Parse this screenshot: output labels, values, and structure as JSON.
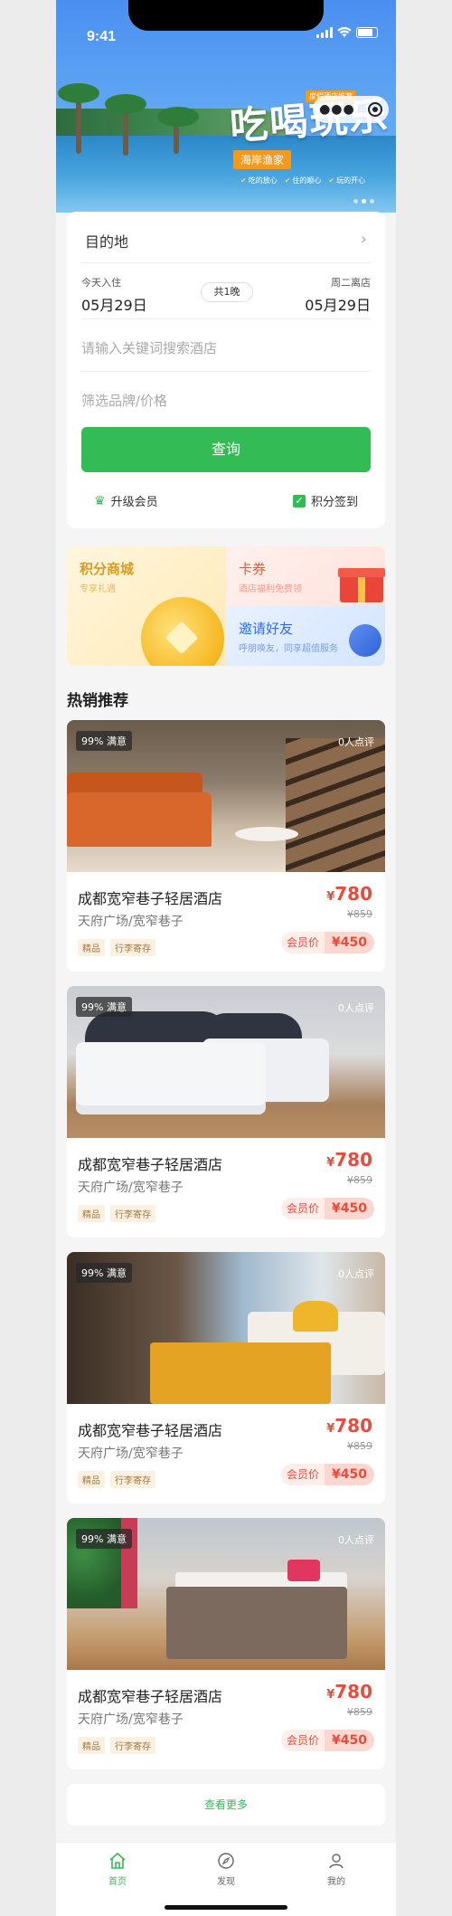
{
  "status": {
    "time": "9:41"
  },
  "banner": {
    "slogan": "吃喝玩乐",
    "tag": "海岸渔家",
    "badge": "度假酒店推荐",
    "perks": [
      "吃的放心",
      "住的顺心",
      "玩的开心"
    ]
  },
  "search": {
    "destination_label": "目的地",
    "checkin_label": "今天入住",
    "checkin_date": "05月29日",
    "nights": "共1晚",
    "checkout_label": "周二离店",
    "checkout_date": "05月29日",
    "keyword_placeholder": "请输入关键词搜索酒店",
    "brand_placeholder": "筛选品牌/价格",
    "query_button": "查询",
    "upgrade_member": "升级会员",
    "points_checkin": "积分签到"
  },
  "promos": {
    "mall": {
      "title": "积分商城",
      "subtitle": "专享礼遇"
    },
    "coupon": {
      "title": "卡券",
      "subtitle": "酒店福利免费领"
    },
    "invite": {
      "title": "邀请好友",
      "subtitle": "呼朋唤友，同享超值服务"
    }
  },
  "section_title": "热销推荐",
  "hotels": [
    {
      "satisfaction": "99% 满意",
      "reviews": "0人点评",
      "name": "成都宽窄巷子轻居酒店",
      "address": "天府广场/宽窄巷子",
      "tags": [
        "精品",
        "行李寄存"
      ],
      "currency": "¥",
      "price": "780",
      "original_price": "¥859",
      "member_label": "会员价",
      "member_price": "¥450"
    },
    {
      "satisfaction": "99% 满意",
      "reviews": "0人点评",
      "name": "成都宽窄巷子轻居酒店",
      "address": "天府广场/宽窄巷子",
      "tags": [
        "精品",
        "行李寄存"
      ],
      "currency": "¥",
      "price": "780",
      "original_price": "¥859",
      "member_label": "会员价",
      "member_price": "¥450"
    },
    {
      "satisfaction": "99% 满意",
      "reviews": "0人点评",
      "name": "成都宽窄巷子轻居酒店",
      "address": "天府广场/宽窄巷子",
      "tags": [
        "精品",
        "行李寄存"
      ],
      "currency": "¥",
      "price": "780",
      "original_price": "¥859",
      "member_label": "会员价",
      "member_price": "¥450"
    },
    {
      "satisfaction": "99% 满意",
      "reviews": "0人点评",
      "name": "成都宽窄巷子轻居酒店",
      "address": "天府广场/宽窄巷子",
      "tags": [
        "精品",
        "行李寄存"
      ],
      "currency": "¥",
      "price": "780",
      "original_price": "¥859",
      "member_label": "会员价",
      "member_price": "¥450"
    }
  ],
  "load_more": "查看更多",
  "tabbar": [
    {
      "label": "首页",
      "icon": "home-icon",
      "active": true
    },
    {
      "label": "发现",
      "icon": "compass-icon",
      "active": false
    },
    {
      "label": "我的",
      "icon": "user-icon",
      "active": false
    }
  ],
  "colors": {
    "accent": "#33bb55",
    "price": "#e74c3c",
    "banner": "#4a8ff0"
  }
}
